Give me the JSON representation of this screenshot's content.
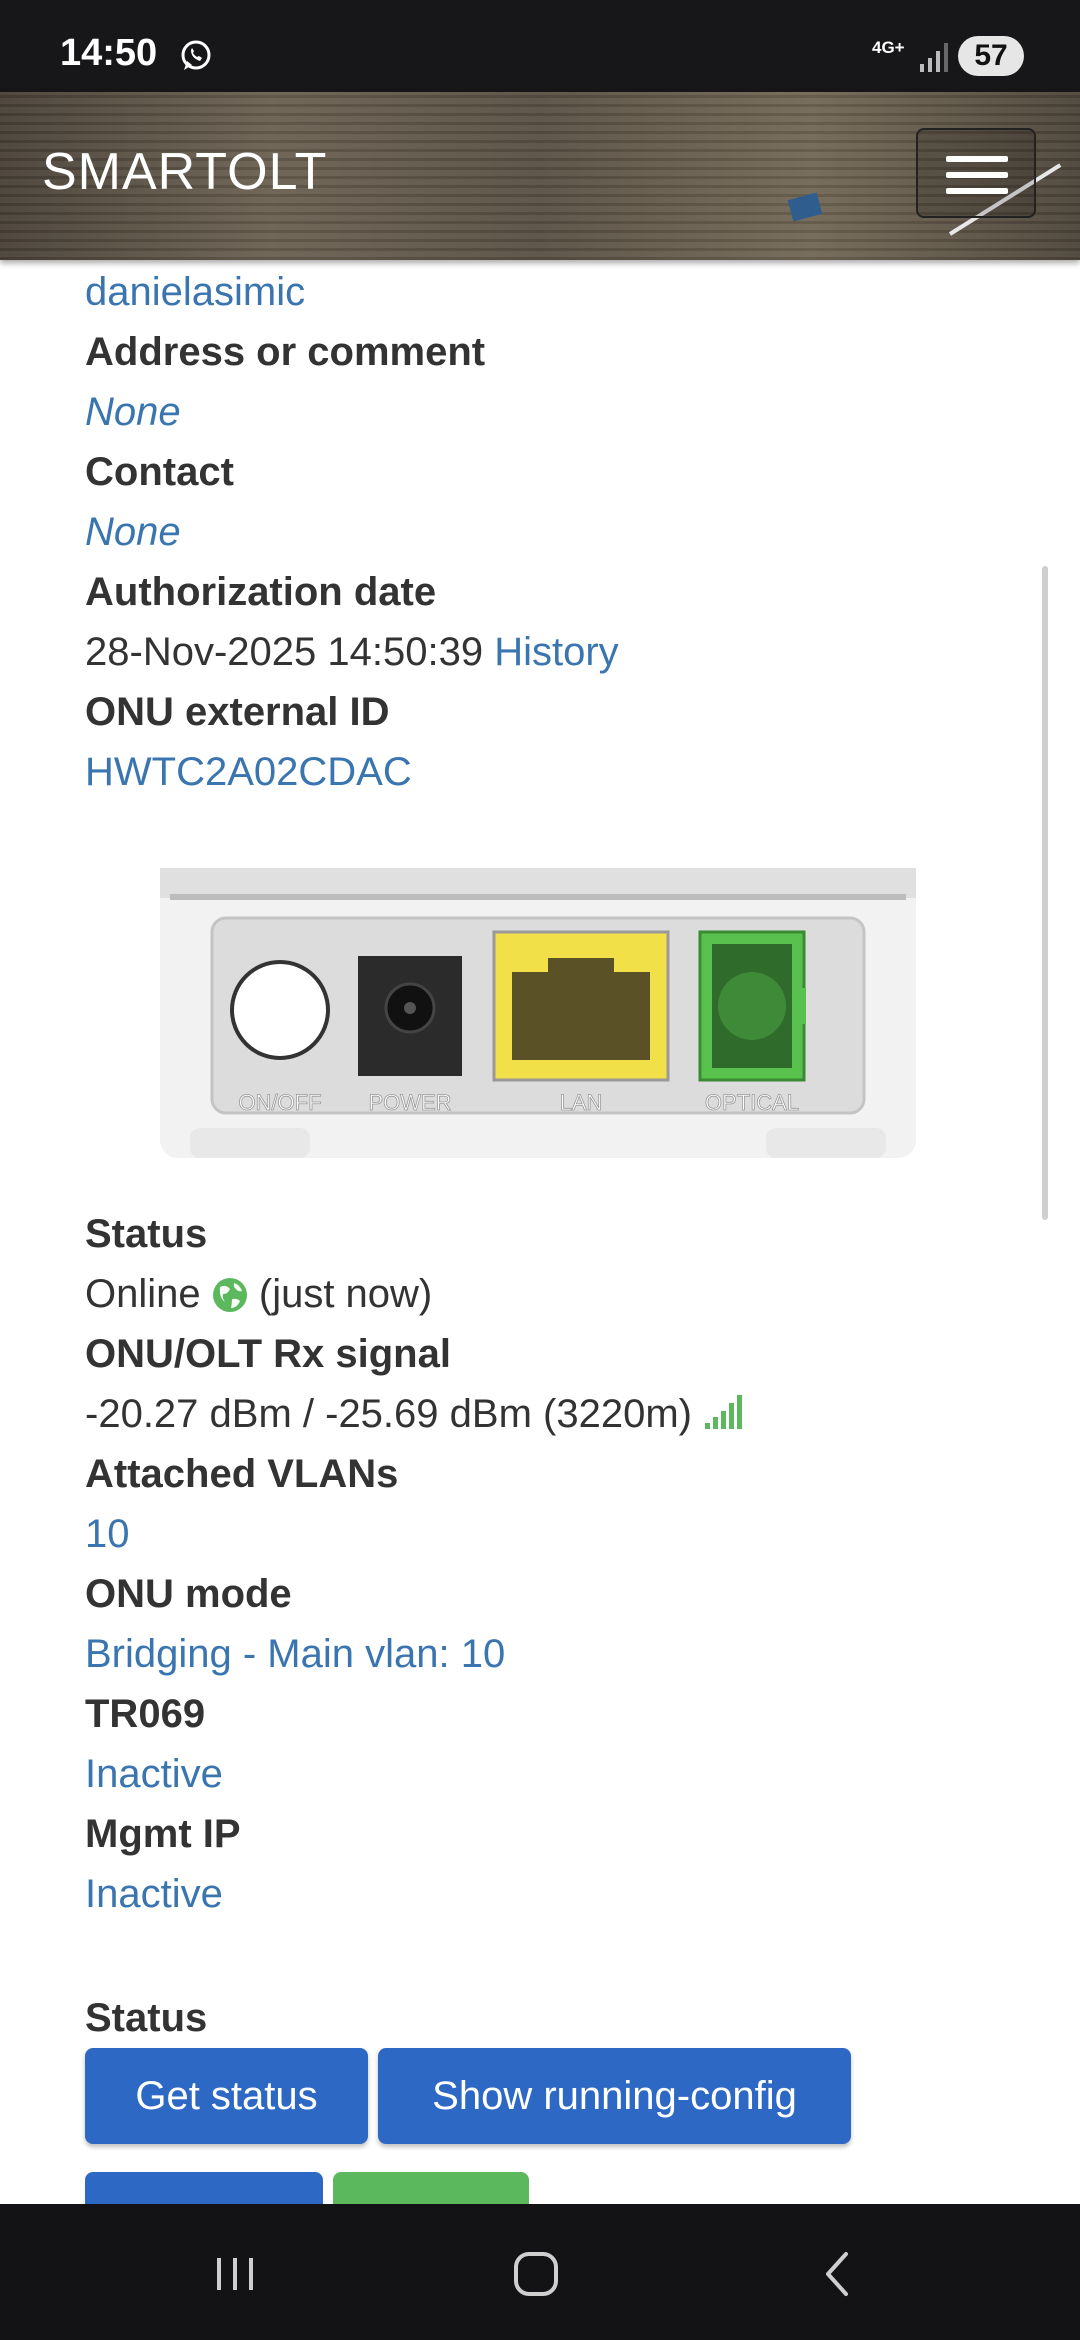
{
  "status_bar": {
    "time": "14:50",
    "network": "4G+",
    "battery": "57",
    "icons": [
      "whatsapp-icon",
      "signal-icon"
    ]
  },
  "navbar": {
    "brand": "SMARTOLT",
    "menu_icon": "hamburger-icon"
  },
  "details": {
    "username": "danielasimic",
    "address_label": "Address or comment",
    "address_value": "None",
    "contact_label": "Contact",
    "contact_value": "None",
    "auth_label": "Authorization date",
    "auth_value": "28-Nov-2025 14:50:39",
    "auth_history": "History",
    "ext_id_label": "ONU external ID",
    "ext_id_value": "HWTC2A02CDAC",
    "device_ports": [
      "ON/OFF",
      "POWER",
      "LAN",
      "OPTICAL"
    ],
    "status_label": "Status",
    "status_value": "Online",
    "status_time": "(just now)",
    "signal_label": "ONU/OLT Rx signal",
    "signal_value": "-20.27 dBm / -25.69 dBm (3220m)",
    "vlans_label": "Attached VLANs",
    "vlans_value": "10",
    "mode_label": "ONU mode",
    "mode_value": "Bridging - Main vlan: 10",
    "tr069_label": "TR069",
    "tr069_value": "Inactive",
    "mgmt_label": "Mgmt IP",
    "mgmt_value": "Inactive"
  },
  "actions": {
    "section_label": "Status",
    "get_status": "Get status",
    "show_config": "Show running-config"
  },
  "colors": {
    "link": "#3a75b0",
    "primary_button": "#2c68c4",
    "success_button": "#5cb85c",
    "online_icon": "#5cb85c"
  }
}
